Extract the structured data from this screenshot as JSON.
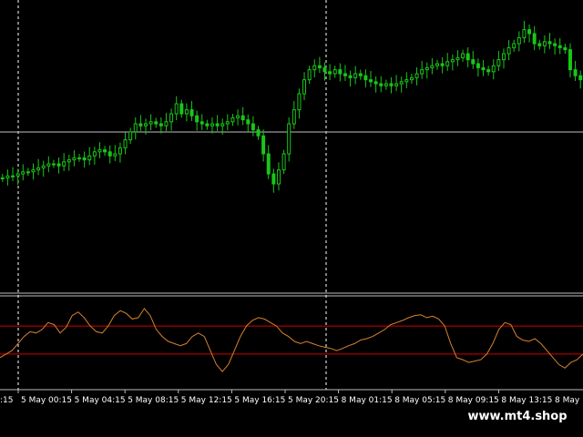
{
  "chart_data": [
    {
      "type": "candlestick",
      "panel": "price",
      "colors": {
        "background": "#000000",
        "bull": "#19c619",
        "bear": "#19c619",
        "crosshair": "#c0c0c0",
        "period_separator": "#ffffff"
      },
      "grid": false,
      "close_trace": [
        0.18,
        0.19,
        0.19,
        0.2,
        0.21,
        0.21,
        0.22,
        0.23,
        0.24,
        0.25,
        0.25,
        0.24,
        0.26,
        0.27,
        0.28,
        0.28,
        0.27,
        0.29,
        0.31,
        0.32,
        0.31,
        0.29,
        0.3,
        0.33,
        0.37,
        0.41,
        0.45,
        0.44,
        0.45,
        0.46,
        0.45,
        0.44,
        0.46,
        0.5,
        0.55,
        0.5,
        0.52,
        0.49,
        0.46,
        0.45,
        0.44,
        0.45,
        0.44,
        0.45,
        0.46,
        0.48,
        0.49,
        0.47,
        0.45,
        0.42,
        0.39,
        0.3,
        0.2,
        0.15,
        0.22,
        0.3,
        0.45,
        0.52,
        0.6,
        0.67,
        0.72,
        0.74,
        0.73,
        0.71,
        0.7,
        0.72,
        0.7,
        0.69,
        0.68,
        0.7,
        0.69,
        0.67,
        0.66,
        0.65,
        0.64,
        0.65,
        0.64,
        0.65,
        0.66,
        0.67,
        0.68,
        0.7,
        0.72,
        0.73,
        0.74,
        0.75,
        0.74,
        0.76,
        0.77,
        0.78,
        0.8,
        0.77,
        0.75,
        0.73,
        0.72,
        0.71,
        0.74,
        0.77,
        0.8,
        0.83,
        0.85,
        0.88,
        0.92,
        0.9,
        0.85,
        0.84,
        0.86,
        0.85,
        0.84,
        0.83,
        0.82,
        0.72,
        0.69,
        0.67
      ],
      "levels": {
        "horizontal_crosshair_level": 0.44
      }
    },
    {
      "type": "line",
      "panel": "oscillator",
      "colors": {
        "line": "#d7822f",
        "upper_level": "#d40000",
        "lower_level": "#d40000"
      },
      "upper_level": 0.7,
      "lower_level": 0.3,
      "values": [
        0.25,
        0.3,
        0.35,
        0.45,
        0.55,
        0.62,
        0.6,
        0.65,
        0.75,
        0.72,
        0.6,
        0.68,
        0.85,
        0.9,
        0.82,
        0.7,
        0.62,
        0.6,
        0.7,
        0.85,
        0.92,
        0.88,
        0.8,
        0.82,
        0.95,
        0.85,
        0.65,
        0.55,
        0.48,
        0.45,
        0.42,
        0.45,
        0.55,
        0.6,
        0.55,
        0.35,
        0.15,
        0.05,
        0.15,
        0.35,
        0.55,
        0.7,
        0.78,
        0.82,
        0.8,
        0.75,
        0.7,
        0.6,
        0.55,
        0.48,
        0.45,
        0.48,
        0.45,
        0.42,
        0.4,
        0.38,
        0.35,
        0.38,
        0.42,
        0.45,
        0.5,
        0.52,
        0.55,
        0.6,
        0.65,
        0.72,
        0.75,
        0.78,
        0.82,
        0.85,
        0.86,
        0.82,
        0.84,
        0.8,
        0.7,
        0.45,
        0.25,
        0.22,
        0.18,
        0.2,
        0.22,
        0.3,
        0.45,
        0.65,
        0.75,
        0.72,
        0.55,
        0.5,
        0.48,
        0.52,
        0.45,
        0.35,
        0.25,
        0.15,
        0.1,
        0.18,
        0.22,
        0.3
      ]
    }
  ],
  "x_axis": {
    "labels": [
      "5 May 00:15",
      "5 May 04:15",
      "5 May 08:15",
      "5 May 12:15",
      "5 May 16:15",
      "5 May 20:15",
      "8 May 01:15",
      "8 May 05:15",
      "8 May 09:15",
      "8 May 13:15"
    ],
    "left_partial_label": ":15",
    "right_partial_label": "8 May 1"
  },
  "watermark": "www.mt4.shop"
}
